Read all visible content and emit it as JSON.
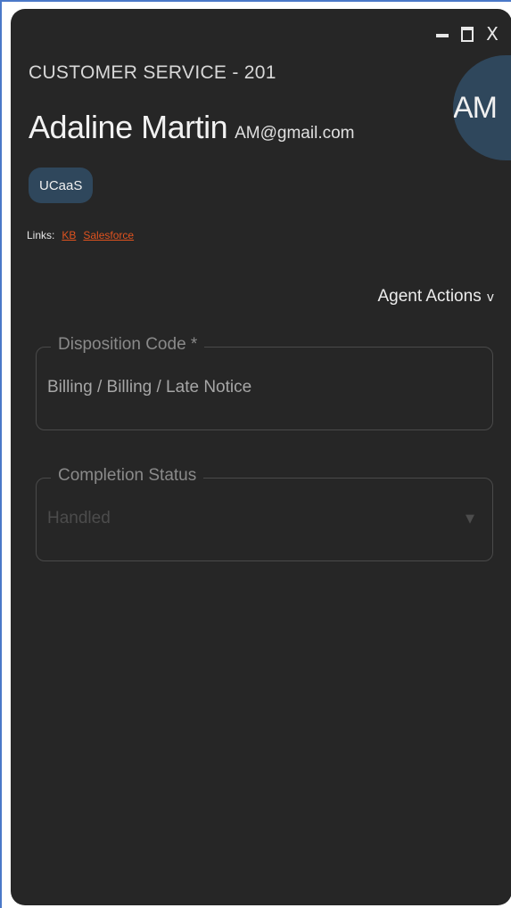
{
  "window": {
    "controls": {
      "minimize_icon": "minimize-icon",
      "maximize_icon": "maximize-icon",
      "close_label": "X"
    }
  },
  "header": {
    "queue": "CUSTOMER SERVICE - 201",
    "customer_name": "Adaline Martin",
    "email": "AM@gmail.com",
    "avatar_initials": "AM",
    "badge": "UCaaS"
  },
  "links": {
    "label": "Links:",
    "items": [
      {
        "label": "KB"
      },
      {
        "label": "Salesforce"
      }
    ]
  },
  "agent_actions": {
    "label": "Agent Actions",
    "chevron": "v"
  },
  "form": {
    "disposition": {
      "label": "Disposition Code *",
      "value": "Billing / Billing / Late Notice"
    },
    "completion": {
      "label": "Completion Status",
      "value": "Handled",
      "arrow": "▼"
    }
  },
  "colors": {
    "panel_bg": "#262626",
    "accent": "#2f475c",
    "link": "#e0531f",
    "frame_border": "#4a78c8"
  }
}
